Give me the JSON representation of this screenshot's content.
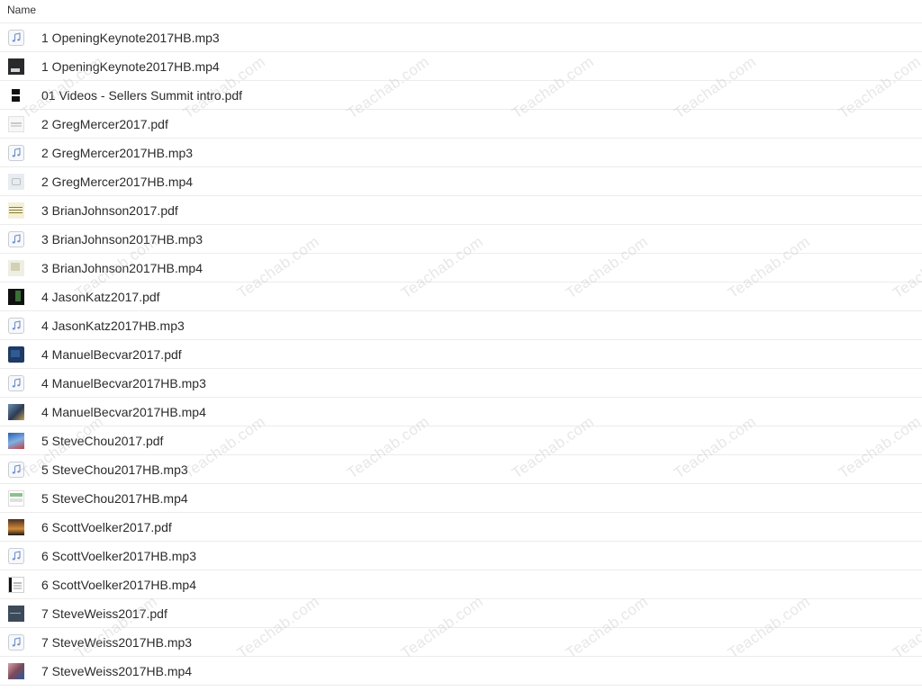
{
  "header": {
    "name_label": "Name"
  },
  "files": [
    {
      "name": "1 OpeningKeynote2017HB.mp3",
      "thumb": "t-audio"
    },
    {
      "name": "1 OpeningKeynote2017HB.mp4",
      "thumb": "t-dark"
    },
    {
      "name": "01 Videos - Sellers Summit intro.pdf",
      "thumb": "t-bars"
    },
    {
      "name": "2 GregMercer2017.pdf",
      "thumb": "t-page"
    },
    {
      "name": "2 GregMercer2017HB.mp3",
      "thumb": "t-audio"
    },
    {
      "name": "2 GregMercer2017HB.mp4",
      "thumb": "t-gray"
    },
    {
      "name": "3 BrianJohnson2017.pdf",
      "thumb": "t-yellow"
    },
    {
      "name": "3 BrianJohnson2017HB.mp3",
      "thumb": "t-audio"
    },
    {
      "name": "3 BrianJohnson2017HB.mp4",
      "thumb": "t-cream"
    },
    {
      "name": "4 JasonKatz2017.pdf",
      "thumb": "t-black"
    },
    {
      "name": "4 JasonKatz2017HB.mp3",
      "thumb": "t-audio"
    },
    {
      "name": "4 ManuelBecvar2017.pdf",
      "thumb": "t-navy"
    },
    {
      "name": "4 ManuelBecvar2017HB.mp3",
      "thumb": "t-audio"
    },
    {
      "name": "4 ManuelBecvar2017HB.mp4",
      "thumb": "t-photo"
    },
    {
      "name": "5 SteveChou2017.pdf",
      "thumb": "t-blue"
    },
    {
      "name": "5 SteveChou2017HB.mp3",
      "thumb": "t-audio"
    },
    {
      "name": "5 SteveChou2017HB.mp4",
      "thumb": "t-green"
    },
    {
      "name": "6 ScottVoelker2017.pdf",
      "thumb": "t-sunset"
    },
    {
      "name": "6 ScottVoelker2017HB.mp3",
      "thumb": "t-audio"
    },
    {
      "name": "6 ScottVoelker2017HB.mp4",
      "thumb": "t-doc"
    },
    {
      "name": "7 SteveWeiss2017.pdf",
      "thumb": "t-slate"
    },
    {
      "name": "7 SteveWeiss2017HB.mp3",
      "thumb": "t-audio"
    },
    {
      "name": "7 SteveWeiss2017HB.mp4",
      "thumb": "t-portrait"
    }
  ],
  "watermark": {
    "text": "Teachab.com"
  }
}
